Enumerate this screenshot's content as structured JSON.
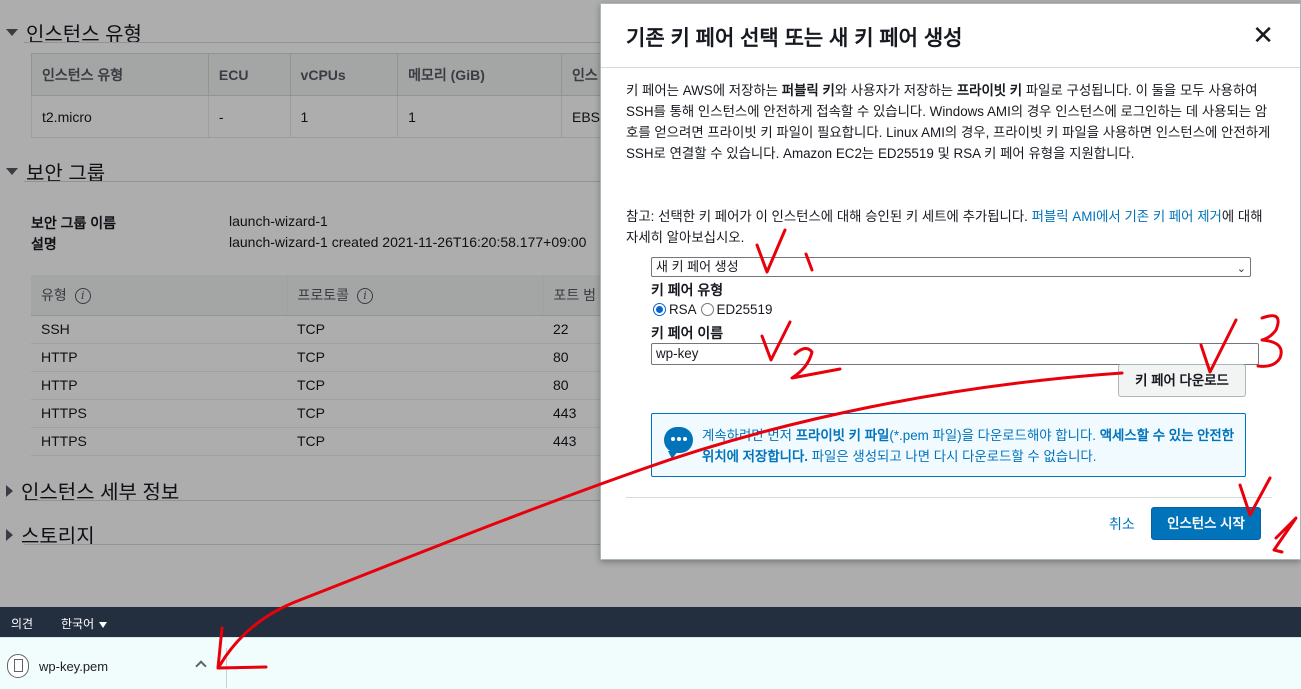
{
  "background": {
    "sections": {
      "instance_type": "인스턴스 유형",
      "security_group": "보안 그룹",
      "instance_details": "인스턴스 세부 정보",
      "storage": "스토리지"
    },
    "instance_table": {
      "headers": [
        "인스턴스 유형",
        "ECU",
        "vCPUs",
        "메모리 (GiB)",
        "인스"
      ],
      "row": [
        "t2.micro",
        "-",
        "1",
        "1",
        "EBS"
      ]
    },
    "sg": {
      "name_label": "보안 그룹 이름",
      "name_value": "launch-wizard-1",
      "desc_label": "설명",
      "desc_value": "launch-wizard-1 created 2021-11-26T16:20:58.177+09:00"
    },
    "rules_table": {
      "headers": [
        "유형",
        "프로토콜",
        "포트 범"
      ],
      "rows": [
        [
          "SSH",
          "TCP",
          "22"
        ],
        [
          "HTTP",
          "TCP",
          "80"
        ],
        [
          "HTTP",
          "TCP",
          "80"
        ],
        [
          "HTTPS",
          "TCP",
          "443"
        ],
        [
          "HTTPS",
          "TCP",
          "443"
        ]
      ]
    }
  },
  "modal": {
    "title": "기존 키 페어 선택 또는 새 키 페어 생성",
    "close": "✕",
    "desc_1": "키 페어는 AWS에 저장하는 ",
    "desc_b1": "퍼블릭 키",
    "desc_2": "와 사용자가 저장하는 ",
    "desc_b2": "프라이빗 키",
    "desc_3": " 파일로 구성됩니다. 이 둘을 모두 사용하여 SSH를 통해 인스턴스에 안전하게 접속할 수 있습니다. Windows AMI의 경우 인스턴스에 로그인하는 데 사용되는 암호를 얻으려면 프라이빗 키 파일이 필요합니다. Linux AMI의 경우, 프라이빗 키 파일을 사용하면 인스턴스에 안전하게 SSH로 연결할 수 있습니다. Amazon EC2는 ED25519 및 RSA 키 페어 유형을 지원합니다.",
    "note_1": "참고: 선택한 키 페어가 이 인스턴스에 대해 승인된 키 세트에 추가됩니다. ",
    "note_link": "퍼블릭 AMI에서 기존 키 페어 제거",
    "note_2": "에 대해 자세히 알아보십시오.",
    "select_value": "새 키 페어 생성",
    "key_type_label": "키 페어 유형",
    "radio_rsa": "RSA",
    "radio_ed": "ED25519",
    "key_name_label": "키 페어 이름",
    "key_name_value": "wp-key",
    "download_button": "키 페어 다운로드",
    "alert_1": "계속하려면 먼저 ",
    "alert_b1": "프라이빗 키 파일",
    "alert_2": "(*.pem 파일)을 다운로드해야 합니다. ",
    "alert_b2": "액세스할 수 있는 안전한 위치에 저장합니다.",
    "alert_3": " 파일은 생성되고 나면 다시 다운로드할 수 없습니다.",
    "cancel": "취소",
    "launch": "인스턴스 시작"
  },
  "footer": {
    "feedback": "의견",
    "language": "한국어"
  },
  "download_shelf": {
    "file_name": "wp-key.pem"
  },
  "colors": {
    "primary": "#0073bb",
    "annotation": "#e8000b",
    "footer": "#232f3e"
  }
}
